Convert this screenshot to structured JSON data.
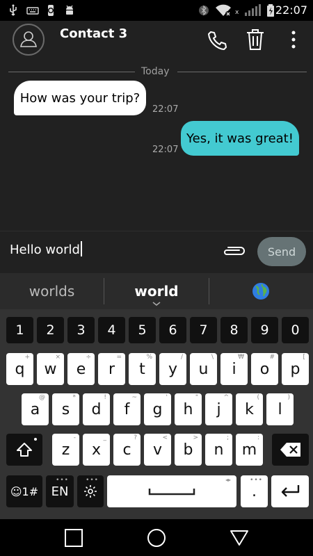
{
  "status_bar": {
    "time": "22:07"
  },
  "header": {
    "contact_name": "Contact 3"
  },
  "conversation": {
    "date_separator": "Today",
    "messages": [
      {
        "direction": "incoming",
        "text": "How was your trip?",
        "time": "22:07"
      },
      {
        "direction": "outgoing",
        "text": "Yes, it was great!",
        "time": "22:07"
      }
    ]
  },
  "composer": {
    "text": "Hello world",
    "send_label": "Send"
  },
  "suggestions": {
    "left": "worlds",
    "center": "world",
    "right_icon": "globe-emoji"
  },
  "keyboard": {
    "number_row": [
      "1",
      "2",
      "3",
      "4",
      "5",
      "6",
      "7",
      "8",
      "9",
      "0"
    ],
    "row1": [
      "q",
      "w",
      "e",
      "r",
      "t",
      "y",
      "u",
      "i",
      "o",
      "p"
    ],
    "row1_sup": [
      "+",
      "×",
      "÷",
      "=",
      "%",
      "/",
      "\\",
      "₩",
      "#",
      "["
    ],
    "row2": [
      "a",
      "s",
      "d",
      "f",
      "g",
      "h",
      "j",
      "k",
      "l"
    ],
    "row2_sup": [
      "@",
      "*",
      "!",
      "~",
      "'",
      "\"",
      "^",
      "(",
      ")"
    ],
    "row3": [
      "z",
      "x",
      "c",
      "v",
      "b",
      "n",
      "m"
    ],
    "row3_sup": [
      "-",
      "_",
      "?",
      "<",
      ">",
      ";",
      ":"
    ],
    "emoji_key": "☺1#",
    "lang_key": "EN",
    "period_key": "."
  },
  "colors": {
    "outgoing_bubble": "#43cad1",
    "incoming_bubble": "#ffffff",
    "send_button": "#667375"
  }
}
